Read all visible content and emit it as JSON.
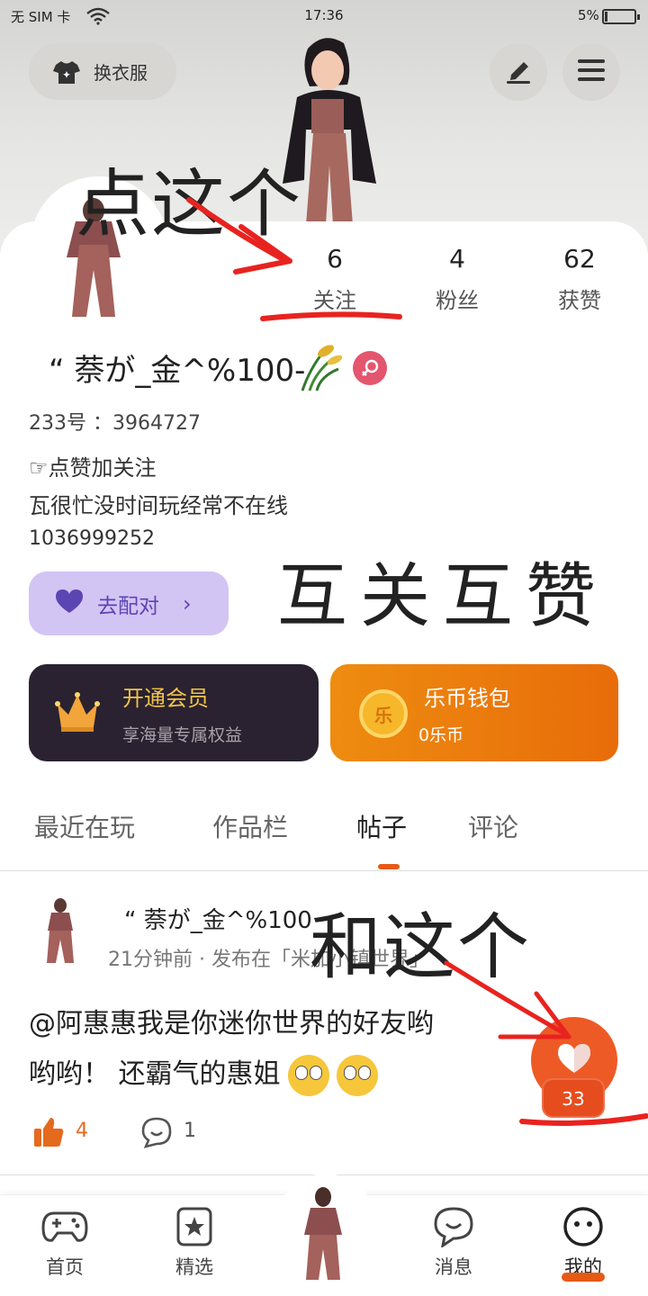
{
  "status_bar": {
    "carrier": "无 SIM 卡",
    "time": "17:36",
    "battery": "5%"
  },
  "header": {
    "dress_button": "换衣服"
  },
  "stats": {
    "following_count": "6",
    "following_label": "关注",
    "fans_count": "4",
    "fans_label": "粉丝",
    "likes_count": "62",
    "likes_label": "获赞"
  },
  "profile": {
    "username": "“ 萘が_金^%100-",
    "account_id": "233号 ：3964727",
    "bio": [
      "☞点赞加关注",
      "瓦很忙没时间玩经常不在线",
      "1036999252"
    ],
    "match_button": "去配对"
  },
  "cards": {
    "vip_title": "开通会员",
    "vip_sub": "享海量专属权益",
    "wallet_title": "乐币钱包",
    "wallet_sub": "0乐币",
    "coin_glyph": "乐"
  },
  "tabs": [
    "最近在玩",
    "作品栏",
    "帖子",
    "评论"
  ],
  "active_tab": "帖子",
  "post": {
    "author": "“ 萘が_金^%100",
    "meta": "21分钟前 · 发布在「米加小镇世界」",
    "line_1": "@阿惠惠我是你迷你世界的好友哟",
    "line_2": "哟哟！ 还霸气的惠姐",
    "like_count": "4",
    "comment_count": "1",
    "favorite_count": "33"
  },
  "bottom_nav": {
    "home": "首页",
    "featured": "精选",
    "messages": "消息",
    "mine": "我的"
  },
  "annotations": {
    "click_this": "点这个",
    "mutual": "互关互赞",
    "and_this": "和这个"
  },
  "colors": {
    "accent": "#e65a15",
    "annotation_red": "#e8231f",
    "match_purple": "#d2c5f4",
    "gender_pink": "#e3566e"
  }
}
